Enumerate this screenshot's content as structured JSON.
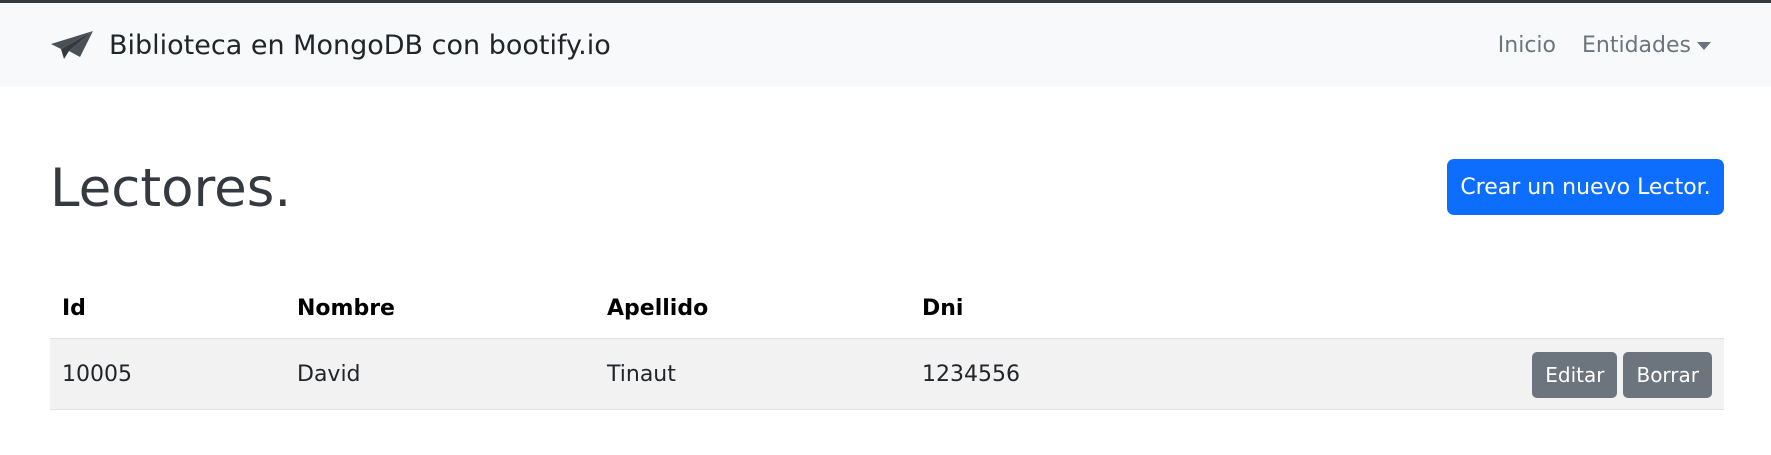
{
  "navbar": {
    "brand_icon": "paper-plane-icon",
    "brand_text": "Biblioteca en MongoDB con bootify.io",
    "links": {
      "inicio": "Inicio",
      "entidades": "Entidades"
    },
    "dropdown_icon": "caret-down-icon"
  },
  "page": {
    "title": "Lectores.",
    "create_button": "Crear un nuevo Lector."
  },
  "table": {
    "headers": [
      "Id",
      "Nombre",
      "Apellido",
      "Dni"
    ],
    "rows": [
      {
        "id": "10005",
        "nombre": "David",
        "apellido": "Tinaut",
        "dni": "1234556",
        "edit_label": "Editar",
        "delete_label": "Borrar"
      }
    ]
  },
  "colors": {
    "primary": "#0d6efd",
    "secondary": "#6c757d",
    "navbar_bg": "#f8f9fa",
    "title": "#343a40",
    "row_striped": "#f2f2f2"
  }
}
